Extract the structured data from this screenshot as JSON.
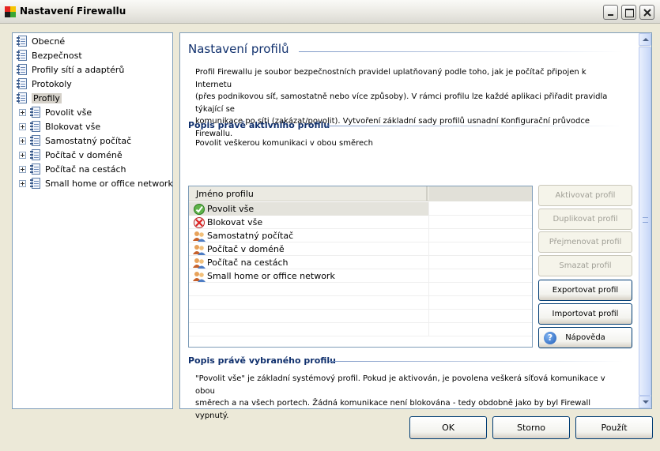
{
  "window": {
    "title": "Nastavení Firewallu",
    "buttons": {
      "minimize": "minimize",
      "maximize": "maximize",
      "close": "close"
    }
  },
  "tree": {
    "items": [
      {
        "label": "Obecné",
        "level": 0,
        "expandable": false,
        "selected": false
      },
      {
        "label": "Bezpečnost",
        "level": 0,
        "expandable": false,
        "selected": false
      },
      {
        "label": "Profily sítí a adaptérů",
        "level": 0,
        "expandable": false,
        "selected": false
      },
      {
        "label": "Protokoly",
        "level": 0,
        "expandable": false,
        "selected": false
      },
      {
        "label": "Profily",
        "level": 0,
        "expandable": false,
        "selected": true
      },
      {
        "label": "Povolit vše",
        "level": 1,
        "expandable": true,
        "selected": false
      },
      {
        "label": "Blokovat vše",
        "level": 1,
        "expandable": true,
        "selected": false
      },
      {
        "label": "Samostatný počítač",
        "level": 1,
        "expandable": true,
        "selected": false
      },
      {
        "label": "Počítač v doméně",
        "level": 1,
        "expandable": true,
        "selected": false
      },
      {
        "label": "Počítač na cestách",
        "level": 1,
        "expandable": true,
        "selected": false
      },
      {
        "label": "Small home or office network",
        "level": 1,
        "expandable": true,
        "selected": false
      }
    ]
  },
  "main": {
    "title": "Nastavení profilů",
    "intro": [
      "Profil Firewallu je soubor bezpečnostních pravidel uplatňovaný podle toho, jak je počítač připojen k Internetu",
      "(přes podnikovou síť, samostatně nebo více způsoby). V rámci profilu lze každé aplikaci přiřadit pravidla týkající se",
      "komunikace po síti (zakázat/povolit). Vytvoření základní sady profilů usnadní Konfigurační průvodce Firewallu."
    ],
    "active_profile": {
      "heading": "Popis právě aktivního profilu",
      "text": "Povolit veškerou komunikaci v obou směrech"
    },
    "table": {
      "header": "Jméno profilu",
      "rows": [
        {
          "name": "Povolit vše",
          "icon": "check-shield-icon",
          "selected": true
        },
        {
          "name": "Blokovat vše",
          "icon": "block-shield-icon",
          "selected": false
        },
        {
          "name": "Samostatný počítač",
          "icon": "users-icon",
          "selected": false
        },
        {
          "name": "Počítač v doméně",
          "icon": "users-icon",
          "selected": false
        },
        {
          "name": "Počítač na cestách",
          "icon": "users-icon",
          "selected": false
        },
        {
          "name": "Small home or office network",
          "icon": "users-icon",
          "selected": false
        }
      ]
    },
    "side_buttons": [
      {
        "label": "Aktivovat profil",
        "enabled": false
      },
      {
        "label": "Duplikovat profil",
        "enabled": false
      },
      {
        "label": "Přejmenovat profil",
        "enabled": false
      },
      {
        "label": "Smazat profil",
        "enabled": false
      },
      {
        "label": "Exportovat profil",
        "enabled": true
      },
      {
        "label": "Importovat profil",
        "enabled": true
      },
      {
        "label": "Nápověda",
        "enabled": true,
        "icon": "help-icon"
      }
    ],
    "selected_profile": {
      "heading": "Popis právě vybraného profilu",
      "text": [
        "\"Povolit vše\" je základní systémový profil. Pokud je aktivován, je povolena veškerá síťová komunikace v obou",
        "směrech a na všech portech. Žádná komunikace není blokována - tedy obdobně jako by byl Firewall vypnutý."
      ]
    }
  },
  "footer": {
    "ok": "OK",
    "cancel": "Storno",
    "apply": "Použít"
  },
  "colors": {
    "heading_blue": "#10306D",
    "border_blue": "#7F9DB9",
    "window_bg": "#ECE9D8"
  }
}
